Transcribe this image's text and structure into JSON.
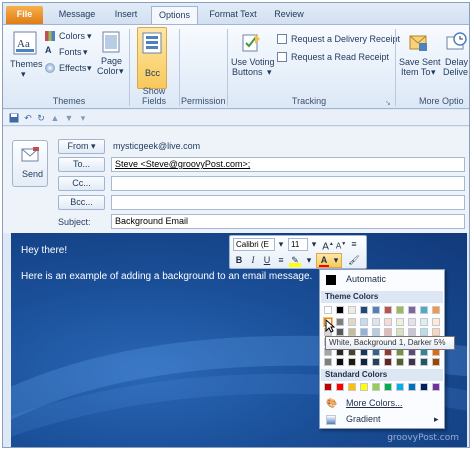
{
  "tabs": [
    "File",
    "Message",
    "Insert",
    "Options",
    "Format Text",
    "Review"
  ],
  "ribbon": {
    "themes": {
      "label": "Themes",
      "colors": "Colors",
      "fonts": "Fonts",
      "effects": "Effects",
      "page_color_1": "Page",
      "page_color_2": "Color",
      "group": "Themes"
    },
    "show_fields": {
      "bcc": "Bcc",
      "group": "Show Fields"
    },
    "permission": {
      "group": "Permission"
    },
    "tracking": {
      "voting_1": "Use Voting",
      "voting_2": "Buttons",
      "delivery": "Request a Delivery Receipt",
      "read": "Request a Read Receipt",
      "group": "Tracking"
    },
    "more_options": {
      "save_sent_1": "Save Sent",
      "save_sent_2": "Item To",
      "delay_1": "Delay",
      "delay_2": "Delive",
      "group": "More Optio"
    }
  },
  "header": {
    "send": "Send",
    "from_label": "From",
    "from_value": "mysticgeek@live.com",
    "to_label": "To...",
    "to_value": "Steve <Steve@groovyPost.com>;",
    "cc_label": "Cc...",
    "bcc_label": "Bcc...",
    "subject_label": "Subject:",
    "subject_value": "Background Email"
  },
  "body": {
    "line1": "Hey there!",
    "line2": "Here is an example of adding a background to an email message."
  },
  "minibar": {
    "font": "Calibri (E",
    "size": "11"
  },
  "color_menu": {
    "automatic": "Automatic",
    "theme_colors": "Theme Colors",
    "standard_colors": "Standard Colors",
    "more_colors": "More Colors...",
    "gradient": "Gradient",
    "tooltip": "White, Background 1, Darker 5%",
    "theme_top": [
      "#ffffff",
      "#000000",
      "#eeece1",
      "#1f497d",
      "#4f81bd",
      "#c0504d",
      "#9bbb59",
      "#8064a2",
      "#4bacc6",
      "#f79646"
    ],
    "theme_shades": [
      [
        "#f2f2f2",
        "#7f7f7f",
        "#ddd9c3",
        "#c6d9f0",
        "#dbe5f1",
        "#f2dcdb",
        "#ebf1dd",
        "#e5e0ec",
        "#dbeef3",
        "#fdeada"
      ],
      [
        "#d8d8d8",
        "#595959",
        "#c4bd97",
        "#8db3e2",
        "#b8cce4",
        "#e5b9b7",
        "#d7e3bc",
        "#ccc1d9",
        "#b7dde8",
        "#fbd5b5"
      ],
      [
        "#bfbfbf",
        "#3f3f3f",
        "#938953",
        "#548dd4",
        "#95b3d7",
        "#d99694",
        "#c3d69b",
        "#b2a2c7",
        "#92cddc",
        "#fac08f"
      ],
      [
        "#a5a5a5",
        "#262626",
        "#494429",
        "#17365d",
        "#366092",
        "#953734",
        "#76923c",
        "#5f497a",
        "#31859b",
        "#e36c09"
      ],
      [
        "#7f7f7f",
        "#0c0c0c",
        "#1d1b10",
        "#0f243e",
        "#244061",
        "#632423",
        "#4f6128",
        "#3f3151",
        "#205867",
        "#974806"
      ]
    ],
    "standard": [
      "#c00000",
      "#ff0000",
      "#ffc000",
      "#ffff00",
      "#92d050",
      "#00b050",
      "#00b0f0",
      "#0070c0",
      "#002060",
      "#7030a0"
    ]
  },
  "watermark": "groovyPost.com"
}
